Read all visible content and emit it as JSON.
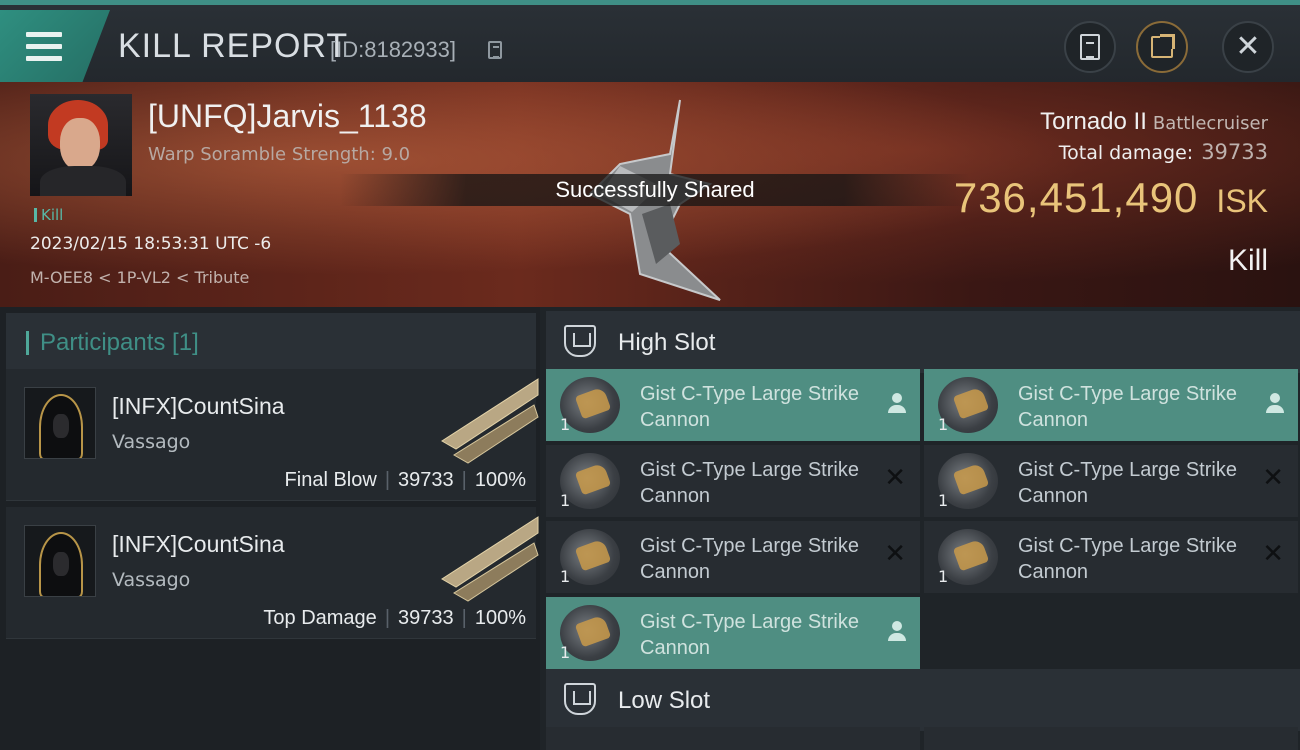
{
  "header": {
    "title": "KILL REPORT",
    "report_id": "[ID:8182933]",
    "icons": {
      "menu": "hamburger-menu-icon",
      "copy": "copy-icon",
      "clipboard": "clipboard-icon",
      "share": "share-export-icon",
      "close": "close-icon"
    },
    "close_glyph": "✕"
  },
  "victim": {
    "name": "[UNFQ]Jarvis_1138",
    "subtitle": "Warp Soramble Strength: 9.0",
    "tag": "Kill",
    "timestamp": "2023/02/15 18:53:31 UTC -6",
    "location": "M-OEE8 < 1P-VL2 < Tribute",
    "ship_name": "Tornado II",
    "ship_class": "Battlecruiser",
    "total_damage_label": "Total damage:",
    "total_damage": "39733",
    "isk_value": "736,451,490",
    "isk_currency": "ISK",
    "result": "Kill"
  },
  "toast": "Successfully Shared",
  "participants": {
    "title": "Participants [1]",
    "rows": [
      {
        "name": "[INFX]CountSina",
        "ship": "Vassago",
        "role": "Final Blow",
        "damage": "39733",
        "percent": "100%"
      },
      {
        "name": "[INFX]CountSina",
        "ship": "Vassago",
        "role": "Top Damage",
        "damage": "39733",
        "percent": "100%"
      }
    ]
  },
  "fittings": {
    "high_slot_title": "High Slot",
    "low_slot_title": "Low Slot",
    "high_slot": [
      {
        "name": "Gist C-Type Large Strike Cannon",
        "qty": "1",
        "status": "dropped"
      },
      {
        "name": "Gist C-Type Large Strike Cannon",
        "qty": "1",
        "status": "dropped"
      },
      {
        "name": "Gist C-Type Large Strike Cannon",
        "qty": "1",
        "status": "destroyed"
      },
      {
        "name": "Gist C-Type Large Strike Cannon",
        "qty": "1",
        "status": "destroyed"
      },
      {
        "name": "Gist C-Type Large Strike Cannon",
        "qty": "1",
        "status": "destroyed"
      },
      {
        "name": "Gist C-Type Large Strike Cannon",
        "qty": "1",
        "status": "destroyed"
      },
      {
        "name": "Gist C-Type Large Strike Cannon",
        "qty": "1",
        "status": "dropped"
      }
    ],
    "status_icons": {
      "dropped": "person-icon",
      "destroyed": "x-icon"
    },
    "destroyed_glyph": "✕"
  },
  "colors": {
    "accent": "#3f8f86",
    "isk_gold": "#e9c47a",
    "selected_row": "#4f8e82"
  }
}
